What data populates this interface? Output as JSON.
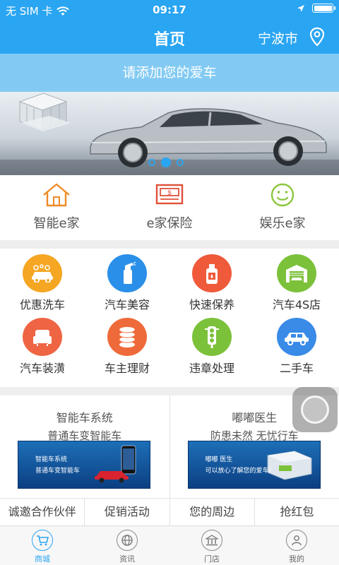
{
  "status_bar": {
    "carrier": "无 SIM 卡",
    "time": "09:17"
  },
  "nav": {
    "title": "首页",
    "city": "宁波市"
  },
  "add_car": "请添加您的爱车",
  "banner": {
    "slide_count": 3,
    "active_index": 1
  },
  "top_services": [
    {
      "label": "智能e家",
      "icon": "house-icon",
      "color": "#f08a24"
    },
    {
      "label": "e家保险",
      "icon": "money-bill-icon",
      "color": "#e0503a"
    },
    {
      "label": "娱乐e家",
      "icon": "smiley-icon",
      "color": "#8cc63f"
    }
  ],
  "grid_row1": [
    {
      "label": "优惠洗车",
      "icon": "car-wash-icon",
      "color": "#f5a623"
    },
    {
      "label": "汽车美容",
      "icon": "spray-bottle-icon",
      "color": "#2a8fe8"
    },
    {
      "label": "快速保养",
      "icon": "oil-can-icon",
      "color": "#ef5a3a"
    },
    {
      "label": "汽车4S店",
      "icon": "garage-icon",
      "color": "#7cc13a"
    }
  ],
  "grid_row2": [
    {
      "label": "汽车装潢",
      "icon": "car-seat-icon",
      "color": "#ef6543"
    },
    {
      "label": "车主理财",
      "icon": "coins-icon",
      "color": "#ef6a3a"
    },
    {
      "label": "违章处理",
      "icon": "traffic-light-icon",
      "color": "#7cc13a"
    },
    {
      "label": "二手车",
      "icon": "car-icon",
      "color": "#3a8ae8"
    }
  ],
  "promo": [
    {
      "title": "智能车系统",
      "subtitle": "普通车变智能车",
      "img_line1": "智能车系统",
      "img_line2": "普通车变智能车"
    },
    {
      "title": "嘟嘟医生",
      "subtitle": "防患未然 无忧行车",
      "img_line1": "嘟嘟 医生",
      "img_line2": "可以放心了解您的爱车!"
    }
  ],
  "links": [
    "诚邀合作伙伴",
    "促销活动",
    "您的周边",
    "抢红包"
  ],
  "tabs": [
    {
      "label": "商城",
      "icon": "cart-icon",
      "active": true
    },
    {
      "label": "资讯",
      "icon": "globe-icon",
      "active": false
    },
    {
      "label": "门店",
      "icon": "store-icon",
      "active": false
    },
    {
      "label": "我的",
      "icon": "user-icon",
      "active": false
    }
  ]
}
